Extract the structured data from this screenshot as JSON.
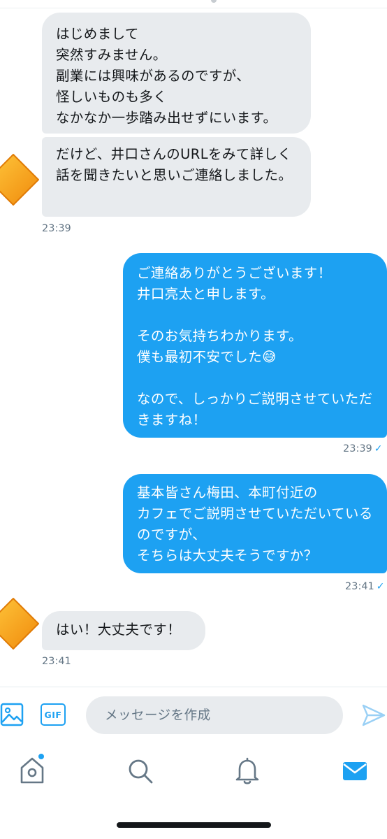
{
  "conversation": {
    "messages": [
      {
        "direction": "incoming",
        "text": "はじめまして\n突然すみません。\n副業には興味があるのですが、\n怪しいものも多く\nなかなか一歩踏み出せずにいます。"
      },
      {
        "direction": "incoming",
        "text": "だけど、井口さんのURLをみて詳しく話を聞きたいと思いご連絡しました。",
        "time": "23:39"
      },
      {
        "direction": "outgoing",
        "text": "ご連絡ありがとうございます！\n井口亮太と申します。\n\nそのお気持ちわかります。\n僕も最初不安でした😅\n\nなので、しっかりご説明させていただきますね！",
        "time": "23:39",
        "status": "✓"
      },
      {
        "direction": "outgoing",
        "text": "基本皆さん梅田、本町付近の\nカフェでご説明させていただいているのですが、\nそちらは大丈夫そうですか？",
        "time": "23:41",
        "status": "✓"
      },
      {
        "direction": "incoming",
        "text": "はい！大丈夫です！",
        "time": "23:41"
      }
    ]
  },
  "composer": {
    "placeholder": "メッセージを作成",
    "gif_label": "GIF",
    "icons": {
      "image": "image-icon",
      "gif": "gif-icon",
      "send": "send-icon"
    }
  },
  "bottom_nav": {
    "items": [
      {
        "icon": "home-icon",
        "badge": true
      },
      {
        "icon": "search-icon"
      },
      {
        "icon": "bell-icon"
      },
      {
        "icon": "mail-icon",
        "active": true
      }
    ]
  },
  "colors": {
    "accent": "#1da1f2",
    "incoming_bubble": "#e8ebee",
    "timestamp": "#657786",
    "avatar": "#f7a21b"
  }
}
